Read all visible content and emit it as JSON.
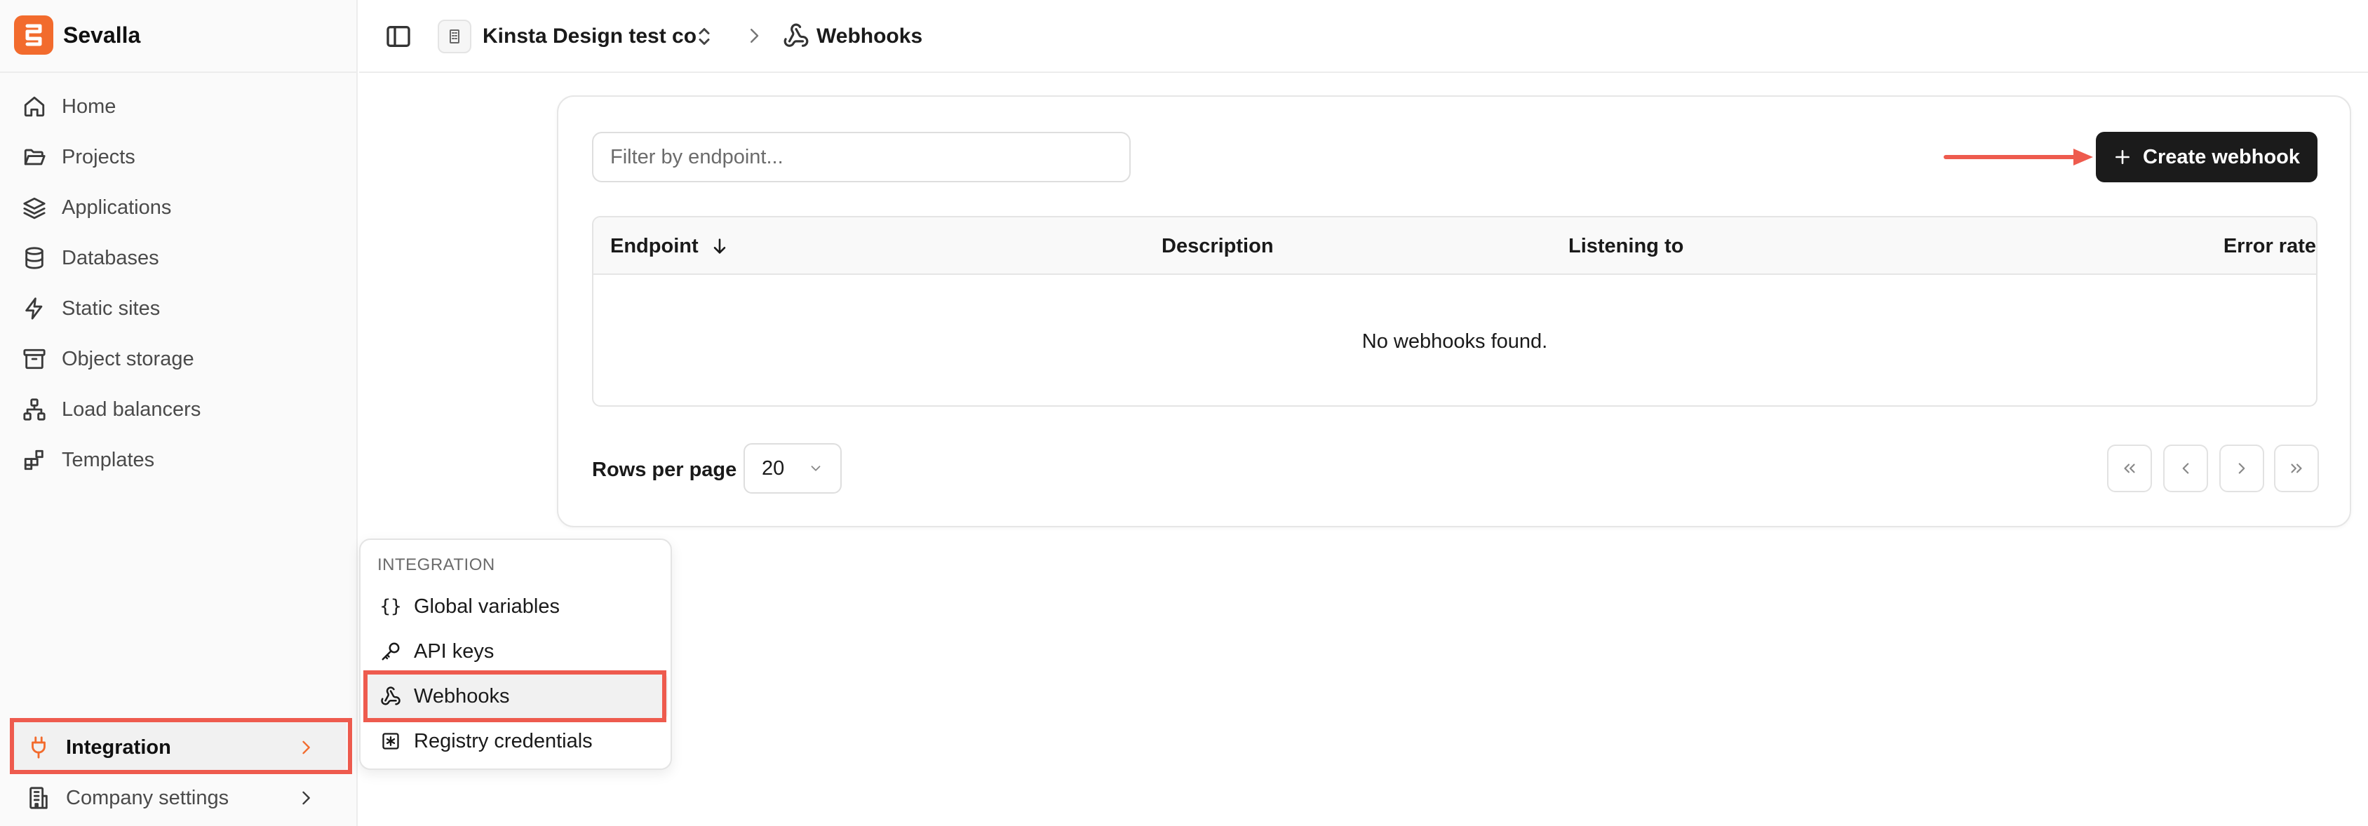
{
  "brand": {
    "name": "Sevalla",
    "color": "#f26b2d"
  },
  "sidebar": {
    "items": [
      {
        "label": "Home",
        "icon": "home-icon"
      },
      {
        "label": "Projects",
        "icon": "folder-icon"
      },
      {
        "label": "Applications",
        "icon": "layers-icon"
      },
      {
        "label": "Databases",
        "icon": "database-icon"
      },
      {
        "label": "Static sites",
        "icon": "bolt-icon"
      },
      {
        "label": "Object storage",
        "icon": "archive-icon"
      },
      {
        "label": "Load balancers",
        "icon": "network-icon"
      },
      {
        "label": "Templates",
        "icon": "blocks-icon"
      }
    ],
    "bottom": [
      {
        "label": "Integration",
        "icon": "plug-icon",
        "active": true
      },
      {
        "label": "Company settings",
        "icon": "building-icon"
      }
    ]
  },
  "header": {
    "org": "Kinsta Design test co",
    "page": "Webhooks"
  },
  "main": {
    "filter_placeholder": "Filter by endpoint...",
    "create_button": "Create webhook",
    "table": {
      "columns": [
        "Endpoint",
        "Description",
        "Listening to",
        "Error rate"
      ],
      "empty_message": "No webhooks found."
    },
    "pagination": {
      "rows_label": "Rows per page",
      "rows_value": "20"
    }
  },
  "popover": {
    "title": "INTEGRATION",
    "items": [
      {
        "label": "Global variables",
        "icon": "braces-icon"
      },
      {
        "label": "API keys",
        "icon": "key-icon"
      },
      {
        "label": "Webhooks",
        "icon": "webhook-icon",
        "active": true
      },
      {
        "label": "Registry credentials",
        "icon": "asterisk-box-icon"
      }
    ]
  },
  "annotation_color": "#ee5b4e"
}
